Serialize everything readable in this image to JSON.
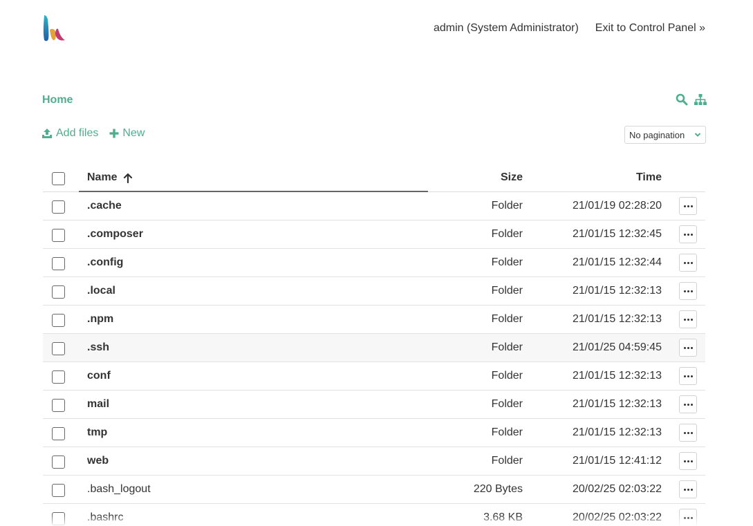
{
  "header": {
    "user": "admin (System Administrator)",
    "exit_link": "Exit to Control Panel »"
  },
  "breadcrumb": {
    "home": "Home"
  },
  "toolbar": {
    "add_files": "Add files",
    "new": "New",
    "pagination": "No pagination"
  },
  "table": {
    "columns": {
      "name": "Name",
      "size": "Size",
      "time": "Time"
    },
    "rows": [
      {
        "name": ".cache",
        "size": "Folder",
        "time": "21/01/19 02:28:20",
        "folder": true
      },
      {
        "name": ".composer",
        "size": "Folder",
        "time": "21/01/15 12:32:45",
        "folder": true
      },
      {
        "name": ".config",
        "size": "Folder",
        "time": "21/01/15 12:32:44",
        "folder": true
      },
      {
        "name": ".local",
        "size": "Folder",
        "time": "21/01/15 12:32:13",
        "folder": true
      },
      {
        "name": ".npm",
        "size": "Folder",
        "time": "21/01/15 12:32:13",
        "folder": true
      },
      {
        "name": ".ssh",
        "size": "Folder",
        "time": "21/01/25 04:59:45",
        "folder": true
      },
      {
        "name": "conf",
        "size": "Folder",
        "time": "21/01/15 12:32:13",
        "folder": true
      },
      {
        "name": "mail",
        "size": "Folder",
        "time": "21/01/15 12:32:13",
        "folder": true
      },
      {
        "name": "tmp",
        "size": "Folder",
        "time": "21/01/15 12:32:13",
        "folder": true
      },
      {
        "name": "web",
        "size": "Folder",
        "time": "21/01/15 12:41:12",
        "folder": true
      },
      {
        "name": ".bash_logout",
        "size": "220 Bytes",
        "time": "20/02/25 02:03:22",
        "folder": false
      },
      {
        "name": ".bashrc",
        "size": "3.68 KB",
        "time": "20/02/25 02:03:22",
        "folder": false
      }
    ]
  },
  "colors": {
    "accent": "#4fae8d",
    "text": "#333333",
    "highlight_row": "#f7f7f7"
  },
  "icons": [
    "logo",
    "search-icon",
    "sitemap-icon",
    "upload-icon",
    "plus-icon",
    "chevron-down-icon",
    "arrow-up-icon",
    "more-icon"
  ]
}
